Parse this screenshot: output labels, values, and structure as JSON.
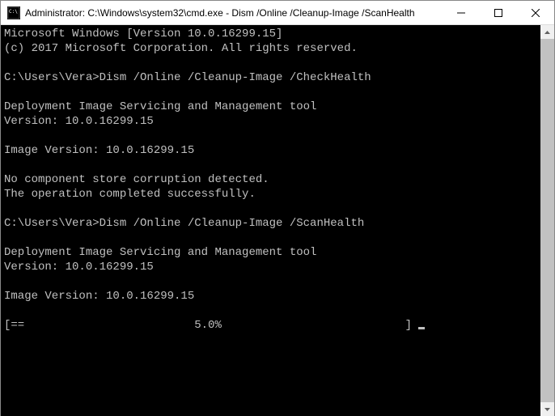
{
  "window": {
    "title": "Administrator: C:\\Windows\\system32\\cmd.exe - Dism  /Online /Cleanup-Image /ScanHealth"
  },
  "terminal": {
    "lines": [
      "Microsoft Windows [Version 10.0.16299.15]",
      "(c) 2017 Microsoft Corporation. All rights reserved.",
      "",
      "C:\\Users\\Vera>Dism /Online /Cleanup-Image /CheckHealth",
      "",
      "Deployment Image Servicing and Management tool",
      "Version: 10.0.16299.15",
      "",
      "Image Version: 10.0.16299.15",
      "",
      "No component store corruption detected.",
      "The operation completed successfully.",
      "",
      "C:\\Users\\Vera>Dism /Online /Cleanup-Image /ScanHealth",
      "",
      "Deployment Image Servicing and Management tool",
      "Version: 10.0.16299.15",
      "",
      "Image Version: 10.0.16299.15",
      ""
    ],
    "progress_line": "[==                         5.0%                           ] "
  }
}
